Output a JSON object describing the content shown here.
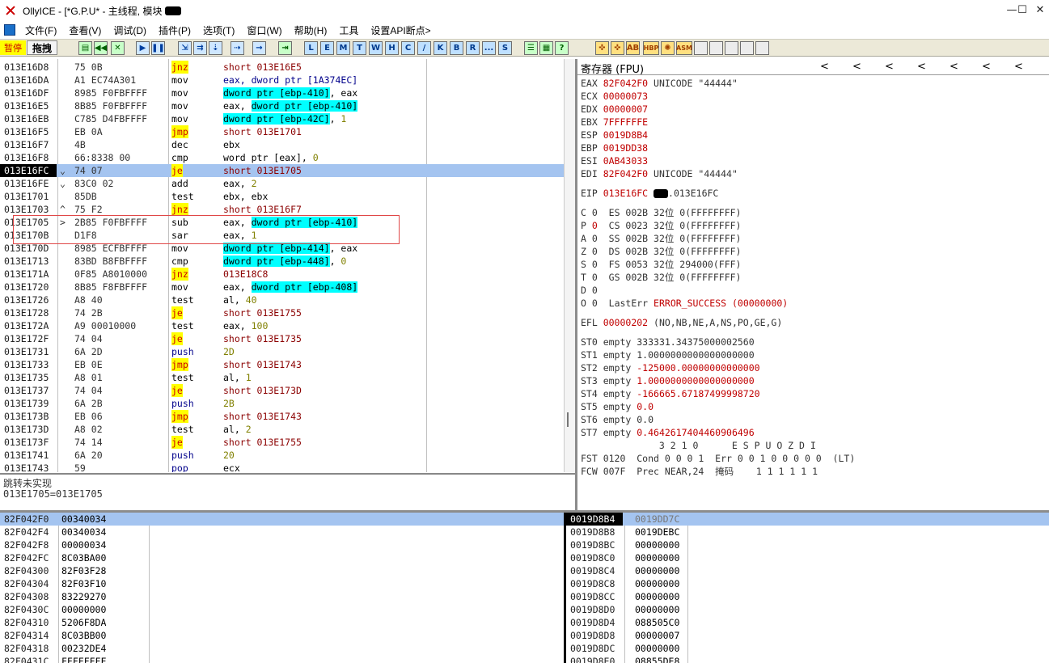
{
  "title": "OllyICE - [*G.P.U* - 主线程, 模块",
  "window_buttons": {
    "min": "—",
    "max": "☐",
    "close": "✕"
  },
  "menu": [
    "文件(F)",
    "查看(V)",
    "调试(D)",
    "插件(P)",
    "选项(T)",
    "窗口(W)",
    "帮助(H)",
    "工具",
    "设置API断点>"
  ],
  "toolbar": {
    "pause": "暂停",
    "drag": "拖拽",
    "letters": [
      "L",
      "E",
      "M",
      "T",
      "W",
      "H",
      "C",
      "/",
      "K",
      "B",
      "R",
      "...",
      "S"
    ]
  },
  "cpu": [
    {
      "addr": "013E16D8",
      "mark": " ",
      "hex": "75 0B",
      "mn": "jnz",
      "mnc": "hl-yellow",
      "op": [
        {
          "t": "short 013E16E5",
          "c": "op-red"
        }
      ]
    },
    {
      "addr": "013E16DA",
      "mark": " ",
      "hex": "A1 EC74A301",
      "mn": "mov",
      "op": [
        {
          "t": "eax, dword ptr [1A374EC]",
          "c": "push"
        }
      ]
    },
    {
      "addr": "013E16DF",
      "mark": " ",
      "hex": "8985 F0FBFFFF",
      "mn": "mov",
      "op": [
        {
          "t": "dword ptr [ebp-410]",
          "c": "hl-cyan"
        },
        {
          "t": ", eax",
          "c": ""
        }
      ]
    },
    {
      "addr": "013E16E5",
      "mark": " ",
      "hex": "8B85 F0FBFFFF",
      "mn": "mov",
      "op": [
        {
          "t": "eax, ",
          "c": ""
        },
        {
          "t": "dword ptr [ebp-410]",
          "c": "hl-cyan"
        }
      ]
    },
    {
      "addr": "013E16EB",
      "mark": " ",
      "hex": "C785 D4FBFFFF",
      "mn": "mov",
      "op": [
        {
          "t": "dword ptr [ebp-42C]",
          "c": "hl-cyan"
        },
        {
          "t": ", ",
          "c": ""
        },
        {
          "t": "1",
          "c": "num"
        }
      ]
    },
    {
      "addr": "013E16F5",
      "mark": " ",
      "hex": "EB 0A",
      "mn": "jmp",
      "mnc": "hl-yellow",
      "op": [
        {
          "t": "short 013E1701",
          "c": "op-red"
        }
      ]
    },
    {
      "addr": "013E16F7",
      "mark": " ",
      "hex": "4B",
      "mn": "dec",
      "op": [
        {
          "t": "ebx",
          "c": ""
        }
      ]
    },
    {
      "addr": "013E16F8",
      "mark": " ",
      "hex": "66:8338 00",
      "mn": "cmp",
      "op": [
        {
          "t": "word ptr [eax], ",
          "c": ""
        },
        {
          "t": "0",
          "c": "num"
        }
      ]
    },
    {
      "addr": "013E16FC",
      "mark": "⌄",
      "hex": "74 07",
      "mn": "je",
      "mnc": "hl-yellow",
      "op": [
        {
          "t": "short 013E1705",
          "c": "op-red"
        }
      ],
      "sel": true
    },
    {
      "addr": "013E16FE",
      "mark": "⌄",
      "hex": "83C0 02",
      "mn": "add",
      "op": [
        {
          "t": "eax, ",
          "c": ""
        },
        {
          "t": "2",
          "c": "num"
        }
      ]
    },
    {
      "addr": "013E1701",
      "mark": " ",
      "hex": "85DB",
      "mn": "test",
      "op": [
        {
          "t": "ebx, ebx",
          "c": ""
        }
      ]
    },
    {
      "addr": "013E1703",
      "mark": "^",
      "hex": "75 F2",
      "mn": "jnz",
      "mnc": "hl-yellow",
      "op": [
        {
          "t": "short 013E16F7",
          "c": "op-red"
        }
      ]
    },
    {
      "addr": "013E1705",
      "mark": ">",
      "hex": "2B85 F0FBFFFF",
      "mn": "sub",
      "op": [
        {
          "t": "eax, ",
          "c": ""
        },
        {
          "t": "dword ptr [ebp-410]",
          "c": "hl-cyan"
        }
      ]
    },
    {
      "addr": "013E170B",
      "mark": " ",
      "hex": "D1F8",
      "mn": "sar",
      "op": [
        {
          "t": "eax, ",
          "c": ""
        },
        {
          "t": "1",
          "c": "num"
        }
      ]
    },
    {
      "addr": "013E170D",
      "mark": " ",
      "hex": "8985 ECFBFFFF",
      "mn": "mov",
      "op": [
        {
          "t": "dword ptr [ebp-414]",
          "c": "hl-cyan"
        },
        {
          "t": ", eax",
          "c": ""
        }
      ]
    },
    {
      "addr": "013E1713",
      "mark": " ",
      "hex": "83BD B8FBFFFF",
      "mn": "cmp",
      "op": [
        {
          "t": "dword ptr [ebp-448]",
          "c": "hl-cyan"
        },
        {
          "t": ", ",
          "c": ""
        },
        {
          "t": "0",
          "c": "num"
        }
      ]
    },
    {
      "addr": "013E171A",
      "mark": " ",
      "hex": "0F85 A8010000",
      "mn": "jnz",
      "mnc": "hl-yellow",
      "op": [
        {
          "t": "013E18C8",
          "c": "op-red"
        }
      ]
    },
    {
      "addr": "013E1720",
      "mark": " ",
      "hex": "8B85 F8FBFFFF",
      "mn": "mov",
      "op": [
        {
          "t": "eax, ",
          "c": ""
        },
        {
          "t": "dword ptr [ebp-408]",
          "c": "hl-cyan"
        }
      ]
    },
    {
      "addr": "013E1726",
      "mark": " ",
      "hex": "A8 40",
      "mn": "test",
      "op": [
        {
          "t": "al, ",
          "c": ""
        },
        {
          "t": "40",
          "c": "num"
        }
      ]
    },
    {
      "addr": "013E1728",
      "mark": " ",
      "hex": "74 2B",
      "mn": "je",
      "mnc": "hl-yellow",
      "op": [
        {
          "t": "short 013E1755",
          "c": "op-red"
        }
      ]
    },
    {
      "addr": "013E172A",
      "mark": " ",
      "hex": "A9 00010000",
      "mn": "test",
      "op": [
        {
          "t": "eax, ",
          "c": ""
        },
        {
          "t": "100",
          "c": "num"
        }
      ]
    },
    {
      "addr": "013E172F",
      "mark": " ",
      "hex": "74 04",
      "mn": "je",
      "mnc": "hl-yellow",
      "op": [
        {
          "t": "short 013E1735",
          "c": "op-red"
        }
      ]
    },
    {
      "addr": "013E1731",
      "mark": " ",
      "hex": "6A 2D",
      "mn": "push",
      "mnc": "push",
      "op": [
        {
          "t": "2D",
          "c": "num"
        }
      ]
    },
    {
      "addr": "013E1733",
      "mark": " ",
      "hex": "EB 0E",
      "mn": "jmp",
      "mnc": "hl-yellow",
      "op": [
        {
          "t": "short 013E1743",
          "c": "op-red"
        }
      ]
    },
    {
      "addr": "013E1735",
      "mark": " ",
      "hex": "A8 01",
      "mn": "test",
      "op": [
        {
          "t": "al, ",
          "c": ""
        },
        {
          "t": "1",
          "c": "num"
        }
      ]
    },
    {
      "addr": "013E1737",
      "mark": " ",
      "hex": "74 04",
      "mn": "je",
      "mnc": "hl-yellow",
      "op": [
        {
          "t": "short 013E173D",
          "c": "op-red"
        }
      ]
    },
    {
      "addr": "013E1739",
      "mark": " ",
      "hex": "6A 2B",
      "mn": "push",
      "mnc": "push",
      "op": [
        {
          "t": "2B",
          "c": "num"
        }
      ]
    },
    {
      "addr": "013E173B",
      "mark": " ",
      "hex": "EB 06",
      "mn": "jmp",
      "mnc": "hl-yellow",
      "op": [
        {
          "t": "short 013E1743",
          "c": "op-red"
        }
      ]
    },
    {
      "addr": "013E173D",
      "mark": " ",
      "hex": "A8 02",
      "mn": "test",
      "op": [
        {
          "t": "al, ",
          "c": ""
        },
        {
          "t": "2",
          "c": "num"
        }
      ]
    },
    {
      "addr": "013E173F",
      "mark": " ",
      "hex": "74 14",
      "mn": "je",
      "mnc": "hl-yellow",
      "op": [
        {
          "t": "short 013E1755",
          "c": "op-red"
        }
      ]
    },
    {
      "addr": "013E1741",
      "mark": " ",
      "hex": "6A 20",
      "mn": "push",
      "mnc": "push",
      "op": [
        {
          "t": "20",
          "c": "num"
        }
      ]
    },
    {
      "addr": "013E1743",
      "mark": " ",
      "hex": "59",
      "mn": "pop",
      "mnc": "push",
      "op": [
        {
          "t": "ecx",
          "c": ""
        }
      ]
    }
  ],
  "info": {
    "line1": "跳转未实现",
    "line2": "013E1705=013E1705"
  },
  "regs": {
    "title": "寄存器 (FPU)",
    "arrows": "<",
    "gp": [
      {
        "n": "EAX",
        "v": "82F042F0",
        "x": " UNICODE \"44444\""
      },
      {
        "n": "ECX",
        "v": "00000073",
        "x": ""
      },
      {
        "n": "EDX",
        "v": "00000007",
        "x": ""
      },
      {
        "n": "EBX",
        "v": "7FFFFFFE",
        "x": ""
      },
      {
        "n": "ESP",
        "v": "0019D8B4",
        "x": ""
      },
      {
        "n": "EBP",
        "v": "0019DD38",
        "x": ""
      },
      {
        "n": "ESI",
        "v": "0AB43033",
        "x": ""
      },
      {
        "n": "EDI",
        "v": "82F042F0",
        "x": " UNICODE \"44444\""
      }
    ],
    "eip": {
      "n": "EIP",
      "v": "013E16FC",
      "x": ".013E16FC"
    },
    "flags": [
      {
        "f": "C 0",
        "seg": "ES 002B 32位 0(FFFFFFFF)",
        "red": false
      },
      {
        "f": "P 0",
        "seg": "CS 0023 32位 0(FFFFFFFF)",
        "red": true
      },
      {
        "f": "A 0",
        "seg": "SS 002B 32位 0(FFFFFFFF)",
        "red": false
      },
      {
        "f": "Z 0",
        "seg": "DS 002B 32位 0(FFFFFFFF)",
        "red": false
      },
      {
        "f": "S 0",
        "seg": "FS 0053 32位 294000(FFF)",
        "red": false
      },
      {
        "f": "T 0",
        "seg": "GS 002B 32位 0(FFFFFFFF)",
        "red": false
      },
      {
        "f": "D 0",
        "seg": "",
        "red": false
      },
      {
        "f": "O 0",
        "seg": "LastErr ",
        "red": false
      }
    ],
    "lasterr": "ERROR_SUCCESS (00000000)",
    "efl": {
      "n": "EFL",
      "v": "00000202",
      "x": " (NO,NB,NE,A,NS,PO,GE,G)"
    },
    "st": [
      {
        "n": "ST0 empty",
        "v": "333331.34375000002560",
        "red": false
      },
      {
        "n": "ST1 empty",
        "v": "1.0000000000000000000",
        "red": false
      },
      {
        "n": "ST2 empty",
        "v": "-125000.00000000000000",
        "red": true
      },
      {
        "n": "ST3 empty",
        "v": "1.0000000000000000000",
        "red": true
      },
      {
        "n": "ST4 empty",
        "v": "-166665.67187499998720",
        "red": true
      },
      {
        "n": "ST5 empty",
        "v": "0.0",
        "red": true
      },
      {
        "n": "ST6 empty",
        "v": "0.0",
        "red": false
      },
      {
        "n": "ST7 empty",
        "v": "0.4642617404460906496",
        "red": true
      }
    ],
    "fst_hdr": "              3 2 1 0      E S P U O Z D I",
    "fst": "FST 0120  Cond 0 0 0 1  Err 0 0 1 0 0 0 0 0  (LT)",
    "fcw": "FCW 007F  Prec NEAR,24  掩码    1 1 1 1 1 1"
  },
  "dump": [
    [
      "82F042F0",
      "00340034"
    ],
    [
      "82F042F4",
      "00340034"
    ],
    [
      "82F042F8",
      "00000034"
    ],
    [
      "82F042FC",
      "8C03BA00"
    ],
    [
      "82F04300",
      "82F03F28"
    ],
    [
      "82F04304",
      "82F03F10"
    ],
    [
      "82F04308",
      "83229270"
    ],
    [
      "82F0430C",
      "00000000"
    ],
    [
      "82F04310",
      "5206F8DA"
    ],
    [
      "82F04314",
      "8C03BB00"
    ],
    [
      "82F04318",
      "00232DE4"
    ],
    [
      "82F0431C",
      "FFFFFFFF"
    ]
  ],
  "stack": [
    [
      "0019D8B4",
      "0019DD7C"
    ],
    [
      "0019D8B8",
      "0019DEBC"
    ],
    [
      "0019D8BC",
      "00000000"
    ],
    [
      "0019D8C0",
      "00000000"
    ],
    [
      "0019D8C4",
      "00000000"
    ],
    [
      "0019D8C8",
      "00000000"
    ],
    [
      "0019D8CC",
      "00000000"
    ],
    [
      "0019D8D0",
      "00000000"
    ],
    [
      "0019D8D4",
      "088505C0"
    ],
    [
      "0019D8D8",
      "00000007"
    ],
    [
      "0019D8DC",
      "00000000"
    ],
    [
      "0019D8E0",
      "08855DE8"
    ]
  ]
}
